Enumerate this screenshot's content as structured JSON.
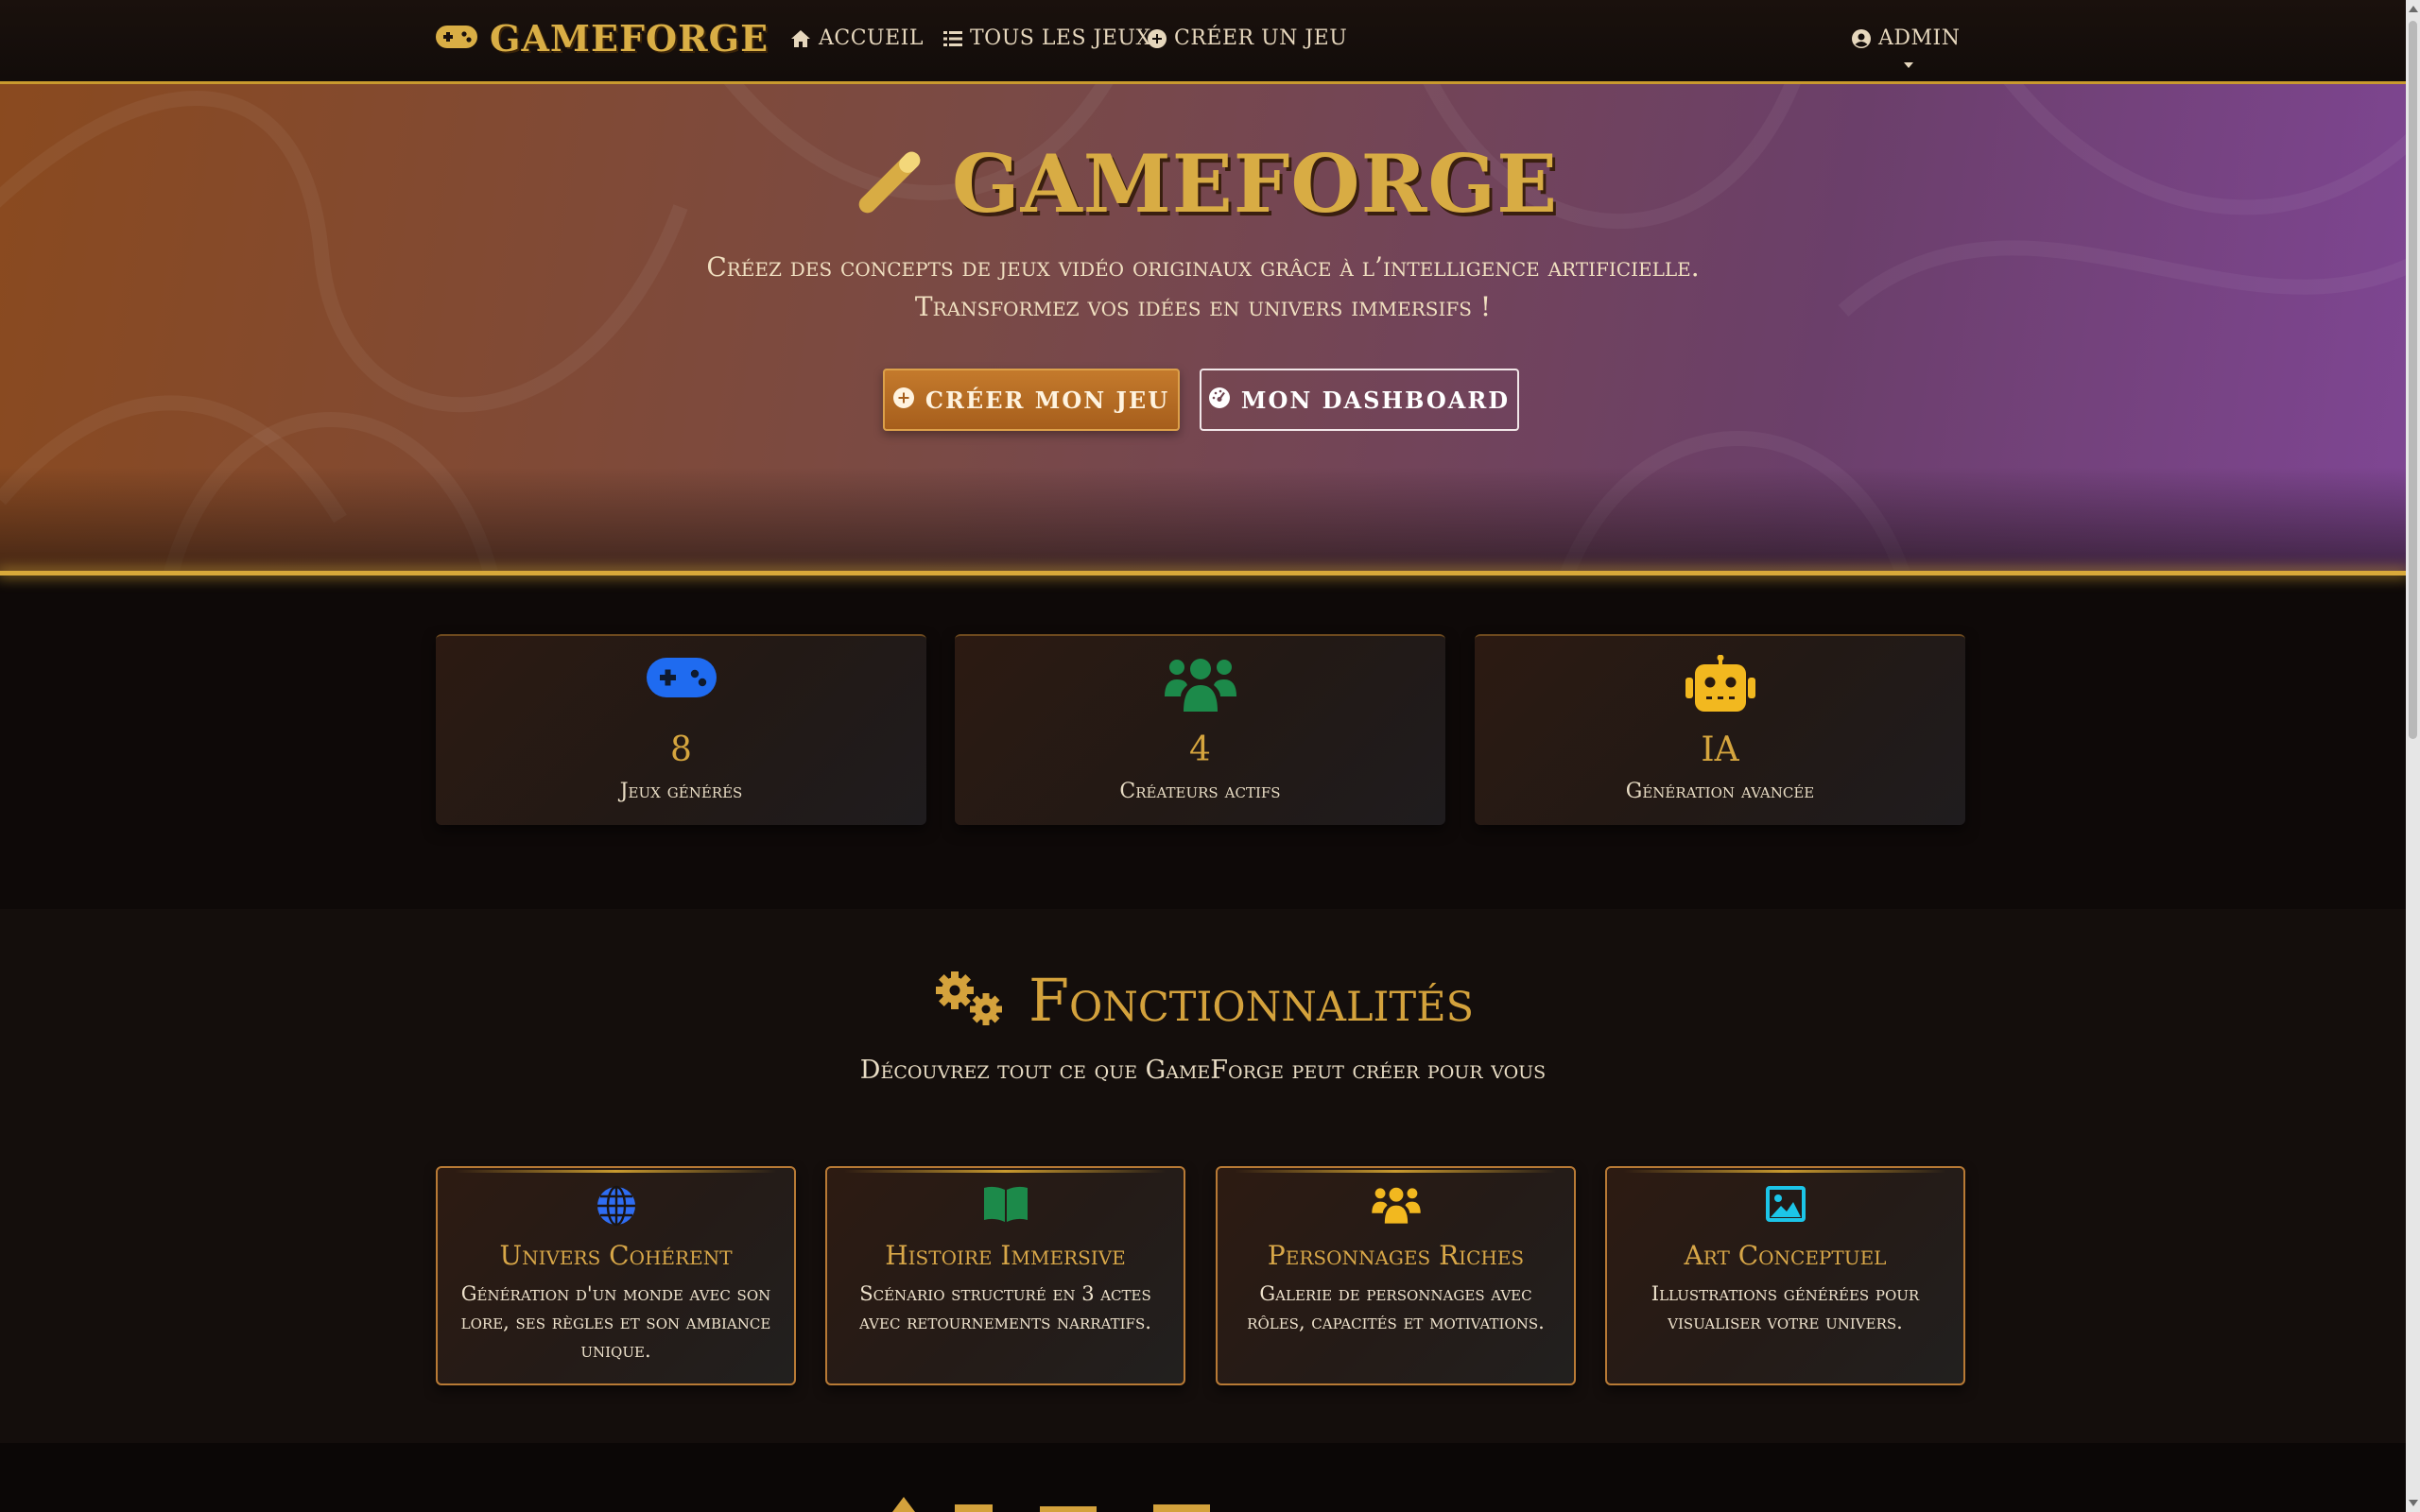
{
  "navbar": {
    "brand": "GAMEFORGE",
    "links": [
      {
        "label": "ACCUEIL",
        "icon": "home-icon"
      },
      {
        "label": "TOUS LES JEUX",
        "icon": "list-icon"
      },
      {
        "label": "CRÉER UN JEU",
        "icon": "plus-circle-icon"
      }
    ],
    "user": {
      "label": "ADMIN",
      "icon": "user-circle-icon"
    }
  },
  "hero": {
    "title": "GAMEFORGE",
    "subtitle": "Créez des concepts de jeux vidéo originaux grâce à l’intelligence artificielle. Transformez vos idées en univers immersifs !",
    "primary_button": "CRÉER MON JEU",
    "secondary_button": "MON DASHBOARD"
  },
  "stats": [
    {
      "value": "8",
      "label": "Jeux générés",
      "icon": "gamepad-icon",
      "color": "#1f6bf0"
    },
    {
      "value": "4",
      "label": "Créateurs actifs",
      "icon": "users-icon",
      "color": "#1c8a4a"
    },
    {
      "value": "IA",
      "label": "Génération avancée",
      "icon": "robot-icon",
      "color": "#f2b81f"
    }
  ],
  "features_section": {
    "title": "Fonctionnalités",
    "subtitle": "Découvrez tout ce que GameForge peut créer pour vous",
    "cards": [
      {
        "title": "Univers Cohérent",
        "description": "Génération d'un monde avec son lore, ses règles et son ambiance unique.",
        "icon": "globe-icon",
        "color": "#2f6df2"
      },
      {
        "title": "Histoire Immersive",
        "description": "Scénario structuré en 3 actes avec retournements narratifs.",
        "icon": "book-icon",
        "color": "#1c8a4a"
      },
      {
        "title": "Personnages Riches",
        "description": "Galerie de personnages avec rôles, capacités et motivations.",
        "icon": "users-icon",
        "color": "#f2b81f"
      },
      {
        "title": "Art Conceptuel",
        "description": "Illustrations générées pour visualiser votre univers.",
        "icon": "image-icon",
        "color": "#1cc5e8"
      }
    ]
  },
  "colors": {
    "gold": "#d8ac44",
    "background": "#0e0908",
    "hero_start": "#8a4a1f",
    "hero_end": "#7f4694"
  }
}
